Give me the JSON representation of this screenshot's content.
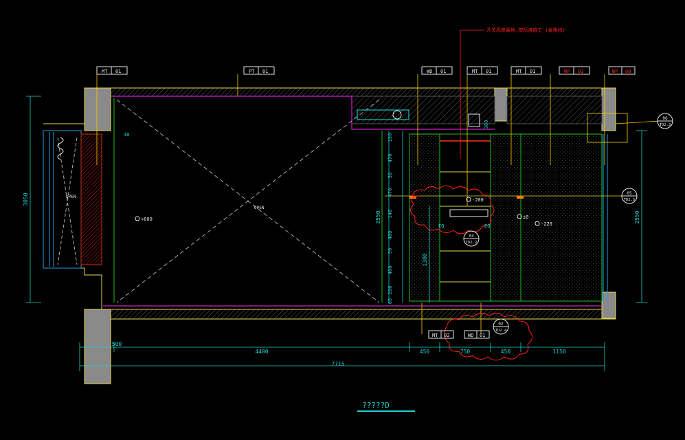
{
  "colors": {
    "background": "#000000",
    "wall": "#e6d84a",
    "wall_fill": "#8a8a8a",
    "hatch": "#6a6a6a",
    "dimension": "#20d0d0",
    "leader": "#ffd000",
    "annotation_red": "#ff2020",
    "magenta": "#d020d0",
    "green": "#20c020",
    "cyan": "#20e0e0",
    "white": "#e8e8e8"
  },
  "top_note": "开关高度离地,按标准施工 (金相线)",
  "tags_top": [
    {
      "code": "MT",
      "num": "01",
      "red": false
    },
    {
      "code": "PT",
      "num": "01",
      "red": false
    },
    {
      "code": "WD",
      "num": "01",
      "red": false
    },
    {
      "code": "MT",
      "num": "01",
      "red": false
    },
    {
      "code": "MT",
      "num": "01",
      "red": false
    },
    {
      "code": "WP",
      "num": "03",
      "red": true
    },
    {
      "code": "WP",
      "num": "08",
      "red": true
    }
  ],
  "tags_bottom": [
    {
      "code": "MT",
      "num": "02"
    },
    {
      "code": "WD",
      "num": "01"
    }
  ],
  "detail_callouts": [
    {
      "top": "06",
      "bottom": "TD2.3"
    },
    {
      "top": "05",
      "bottom": "TD2.5"
    },
    {
      "top": "03",
      "bottom": "TD2.2"
    },
    {
      "top": "02",
      "bottom": "TD2.4"
    }
  ],
  "open_labels": [
    "OPEN",
    "OPEN"
  ],
  "elevations": {
    "left": "+600",
    "ctr_top": "-200",
    "ctr": "±0",
    "right": "-220"
  },
  "dims_left_vertical": "3050",
  "dims_right_vertical": "2550",
  "dims_mid_vertical_total": "2550",
  "dims_mid_vertical_segments": [
    "150",
    "470",
    "50",
    "470",
    "140",
    "480",
    "50",
    "480",
    "200",
    "65"
  ],
  "dim_40": "40",
  "dim_300": "300",
  "dim_1300": "1300",
  "dims_eq": [
    "EQ",
    "EQ"
  ],
  "dims_bottom_segments": [
    "500",
    "4400",
    "450",
    "750",
    "450",
    "1150"
  ],
  "dims_bottom_total": "7715",
  "caption": "?????D"
}
